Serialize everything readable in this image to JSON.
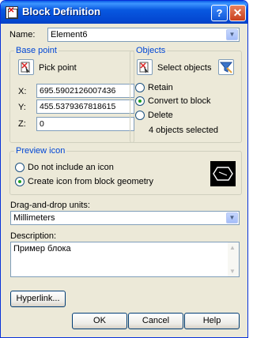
{
  "window": {
    "title": "Block Definition"
  },
  "name": {
    "label": "Name:",
    "value": "Element6"
  },
  "base_point": {
    "group_title": "Base point",
    "pick_label": "Pick point",
    "x_label": "X:",
    "x_value": "695.5902126007436",
    "y_label": "Y:",
    "y_value": "455.5379367818615",
    "z_label": "Z:",
    "z_value": "0"
  },
  "objects": {
    "group_title": "Objects",
    "select_label": "Select objects",
    "retain_label": "Retain",
    "convert_label": "Convert to block",
    "delete_label": "Delete",
    "selected_count": "4 objects selected",
    "selected_option": "convert"
  },
  "preview_icon": {
    "group_title": "Preview icon",
    "no_icon_label": "Do not include an icon",
    "create_label": "Create icon from block geometry",
    "selected_option": "create"
  },
  "units": {
    "label": "Drag-and-drop units:",
    "value": "Millimeters"
  },
  "description": {
    "label": "Description:",
    "value": "Пример блока"
  },
  "buttons": {
    "hyperlink": "Hyperlink...",
    "ok": "OK",
    "cancel": "Cancel",
    "help": "Help"
  },
  "colors": {
    "title_blue": "#0054e3",
    "group_title": "#0046d5",
    "close_red": "#c8401e",
    "radio_dot": "#21a121"
  }
}
